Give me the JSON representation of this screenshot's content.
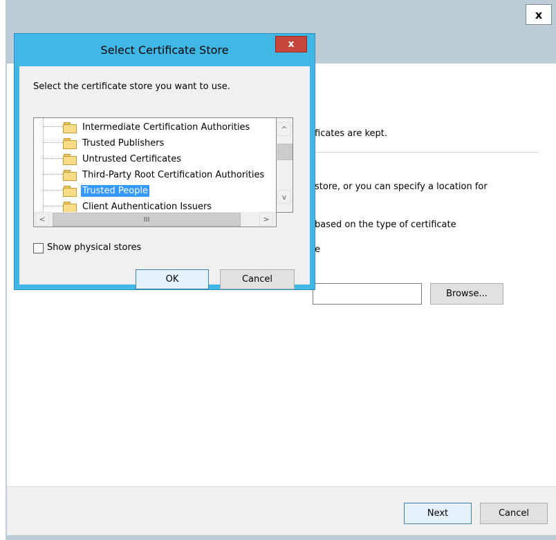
{
  "wizard": {
    "close_label": "x",
    "text_1": "ficates are kept.",
    "text_2": "store, or you can specify a location for",
    "text_3": "based on the type of certificate",
    "text_4": "e",
    "browse_label": "Browse...",
    "next_label": "Next",
    "cancel_label": "Cancel"
  },
  "dialog": {
    "title": "Select Certificate Store",
    "close_label": "x",
    "instruction": "Select the certificate store you want to use.",
    "tree_items": [
      "Intermediate Certification Authorities",
      "Trusted Publishers",
      "Untrusted Certificates",
      "Third-Party Root Certification Authorities",
      "Trusted People",
      "Client Authentication Issuers"
    ],
    "selected_item": "Trusted People",
    "show_physical_label": "Show physical stores",
    "show_physical_checked": false,
    "ok_label": "OK",
    "cancel_label": "Cancel",
    "scroll_up_icon": "^",
    "scroll_down_icon": "v",
    "scroll_left_icon": "<",
    "scroll_right_icon": ">",
    "thumb_grip": "III"
  },
  "colors": {
    "dialog_frame": "#41b7e6",
    "close_button": "#c7463c",
    "selection": "#3399ff"
  }
}
